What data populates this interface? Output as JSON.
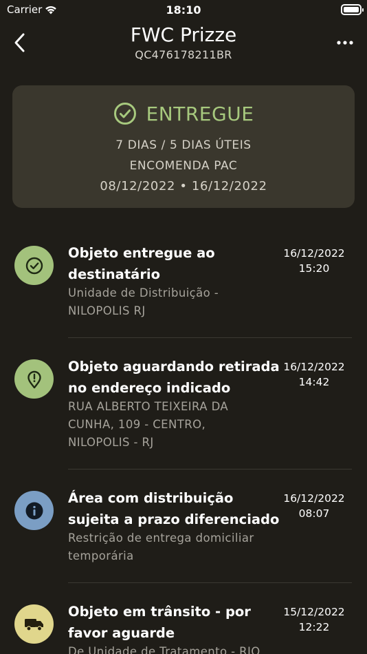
{
  "status_bar": {
    "carrier": "Carrier",
    "time": "18:10"
  },
  "header": {
    "title": "FWC Prizze",
    "tracking_code": "QC476178211BR",
    "back_icon": "chevron-left-icon",
    "more_icon": "ellipsis-icon"
  },
  "summary": {
    "status": "ENTREGUE",
    "status_color": "#a7c97e",
    "duration": "7 DIAS / 5 DIAS ÚTEIS",
    "service": "ENCOMENDA PAC",
    "date_range": "08/12/2022 • 16/12/2022"
  },
  "events": [
    {
      "icon": "check-circle-icon",
      "icon_bg": "#a3c27c",
      "title": "Objeto entregue ao destinatário",
      "detail": "Unidade de Distribuição - NILOPOLIS RJ",
      "date": "16/12/2022",
      "time": "15:20"
    },
    {
      "icon": "location-alert-icon",
      "icon_bg": "#a3c27c",
      "title": "Objeto aguardando retirada no endereço indicado",
      "detail": "RUA ALBERTO TEIXEIRA DA CUNHA, 109 - CENTRO, NILOPOLIS - RJ",
      "date": "16/12/2022",
      "time": "14:42"
    },
    {
      "icon": "info-icon",
      "icon_bg": "#7b9ec4",
      "title": "Área com distribuição sujeita a prazo diferenciado",
      "detail": "Restrição de entrega domiciliar temporária",
      "date": "16/12/2022",
      "time": "08:07"
    },
    {
      "icon": "truck-icon",
      "icon_bg": "#e0d68c",
      "title": "Objeto em trânsito - por favor aguarde",
      "detail": "De Unidade de Tratamento - RIO",
      "date": "15/12/2022",
      "time": "12:22"
    }
  ]
}
